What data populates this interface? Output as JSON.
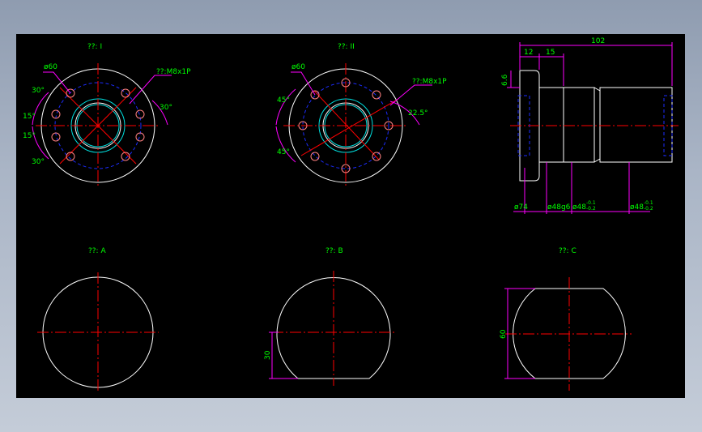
{
  "views": {
    "i": {
      "title": "??: I",
      "dia_label": "ø60",
      "thread_label": "??:M8x1P",
      "angles": [
        "30°",
        "15°",
        "15°",
        "30°",
        "30°"
      ]
    },
    "ii": {
      "title": "??: II",
      "dia_label": "ø60",
      "thread_label": "??:M8x1P",
      "angles": [
        "45°",
        "45°",
        "22.5°"
      ]
    },
    "side": {
      "dims_top": [
        "12",
        "15",
        "102"
      ],
      "dim_left": "6.6",
      "dims_bottom": [
        "ø74",
        "ø48g6",
        "ø48",
        "ø48"
      ],
      "tol_a": [
        "-0.1",
        "-0.2"
      ],
      "tol_b": [
        "-0.1",
        "-0.2"
      ]
    },
    "a": {
      "title": "??: A"
    },
    "b": {
      "title": "??: B",
      "dim": "30"
    },
    "c": {
      "title": "??: C",
      "dim": "60"
    }
  },
  "colors": {
    "background": "#000000",
    "text": "#00ff00",
    "outline": "#ffffff",
    "centerline": "#ff0000",
    "hidden": "#1c2cff",
    "dimension": "#ff00ff"
  }
}
